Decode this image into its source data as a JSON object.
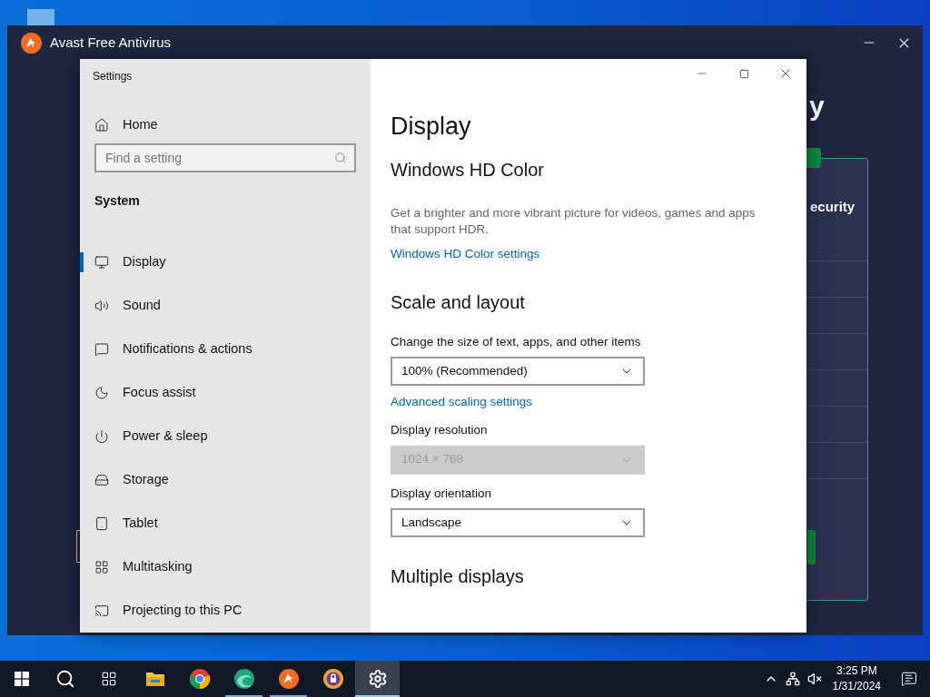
{
  "avast_window": {
    "title": "Avast Free Antivirus",
    "heading_fragment": "y",
    "card_fragment": "ecurity"
  },
  "settings_window": {
    "title": "Settings",
    "home": "Home",
    "search": {
      "placeholder": "Find a setting"
    },
    "section": "System",
    "nav": [
      {
        "kind": "display",
        "label": "Display",
        "selected": true
      },
      {
        "kind": "sound",
        "label": "Sound",
        "selected": false
      },
      {
        "kind": "notifications",
        "label": "Notifications & actions",
        "selected": false
      },
      {
        "kind": "focus",
        "label": "Focus assist",
        "selected": false
      },
      {
        "kind": "power",
        "label": "Power & sleep",
        "selected": false
      },
      {
        "kind": "storage",
        "label": "Storage",
        "selected": false
      },
      {
        "kind": "tablet",
        "label": "Tablet",
        "selected": false
      },
      {
        "kind": "multitasking",
        "label": "Multitasking",
        "selected": false
      },
      {
        "kind": "projecting",
        "label": "Projecting to this PC",
        "selected": false
      }
    ],
    "page_title": "Display",
    "blocks": [
      {
        "kind": "heading",
        "text": "Windows HD Color"
      },
      {
        "kind": "text",
        "text": "Get a brighter and more vibrant picture for videos, games and apps that support HDR."
      },
      {
        "kind": "link",
        "text": "Windows HD Color settings"
      },
      {
        "kind": "heading",
        "text": "Scale and layout"
      },
      {
        "kind": "label",
        "text": "Change the size of text, apps, and other items"
      },
      {
        "kind": "dropdown",
        "text": "100% (Recommended)",
        "disabled": false
      },
      {
        "kind": "link",
        "text": "Advanced scaling settings"
      },
      {
        "kind": "label",
        "text": "Display resolution"
      },
      {
        "kind": "dropdown",
        "text": "1024 × 768",
        "disabled": true
      },
      {
        "kind": "label",
        "text": "Display orientation"
      },
      {
        "kind": "dropdown",
        "text": "Landscape",
        "disabled": false
      },
      {
        "kind": "heading",
        "text": "Multiple displays"
      }
    ]
  },
  "taskbar": {
    "apps": [
      {
        "kind": "explorer",
        "running": false,
        "selected": false
      },
      {
        "kind": "chrome",
        "running": false,
        "selected": false
      },
      {
        "kind": "edge",
        "running": true,
        "selected": false
      },
      {
        "kind": "avast",
        "running": true,
        "selected": false
      },
      {
        "kind": "secure-browser",
        "running": false,
        "selected": false
      },
      {
        "kind": "settings",
        "running": true,
        "selected": true
      }
    ],
    "time": "3:25 PM",
    "date": "1/31/2024"
  }
}
